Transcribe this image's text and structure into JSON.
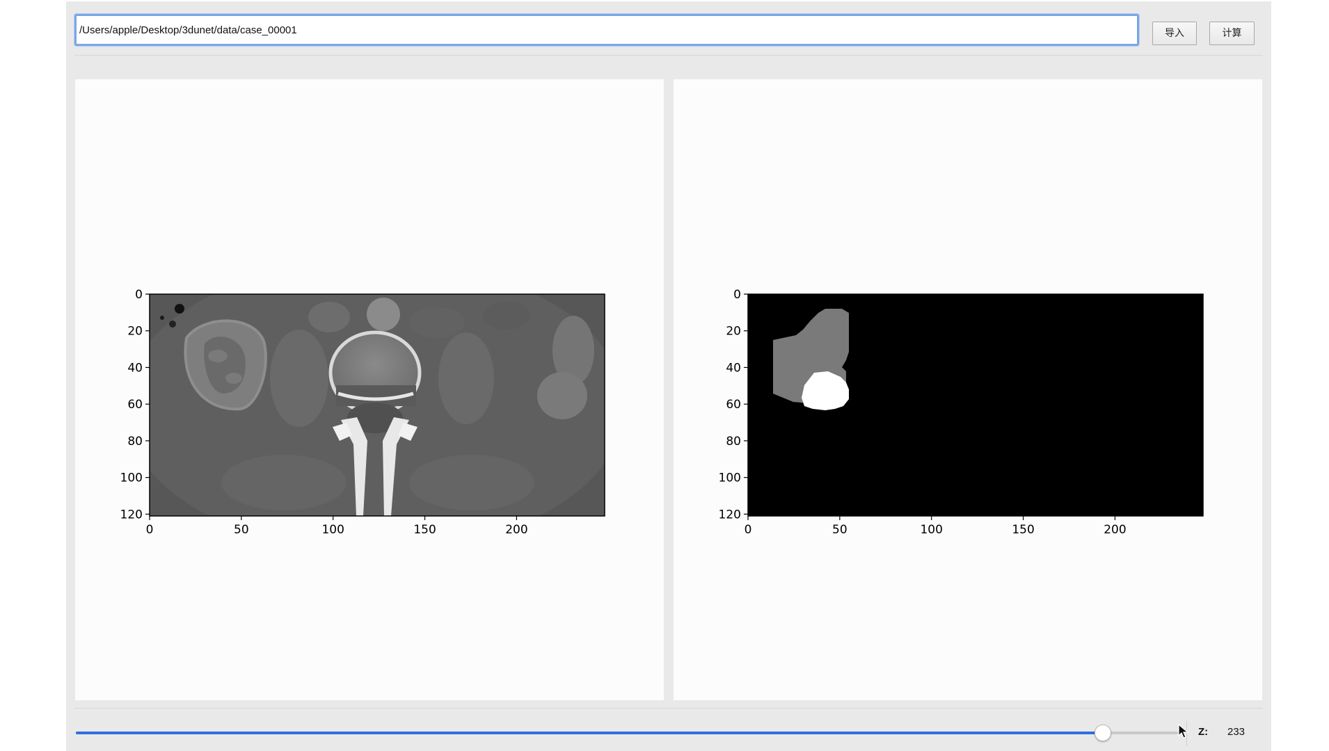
{
  "toolbar": {
    "path_value": "/Users/apple/Desktop/3dunet/data/case_00001",
    "import_label": "导入",
    "compute_label": "计算"
  },
  "ct_plot": {
    "x_ticks": [
      "0",
      "50",
      "100",
      "150",
      "200"
    ],
    "y_ticks": [
      "0",
      "20",
      "40",
      "60",
      "80",
      "100",
      "120"
    ],
    "x_range": [
      0,
      248
    ],
    "y_range": [
      0,
      121
    ]
  },
  "seg_plot": {
    "x_ticks": [
      "0",
      "50",
      "100",
      "150",
      "200"
    ],
    "y_ticks": [
      "0",
      "20",
      "40",
      "60",
      "80",
      "100",
      "120"
    ],
    "x_range": [
      0,
      248
    ],
    "y_range": [
      0,
      121
    ],
    "colors": {
      "background": "#000000",
      "kidney": "#7a7a7a",
      "tumor": "#ffffff"
    }
  },
  "slice_control": {
    "z_label": "Z:",
    "z_value": "233",
    "position_fraction": 0.932,
    "accent_color": "#2f6fe0"
  }
}
